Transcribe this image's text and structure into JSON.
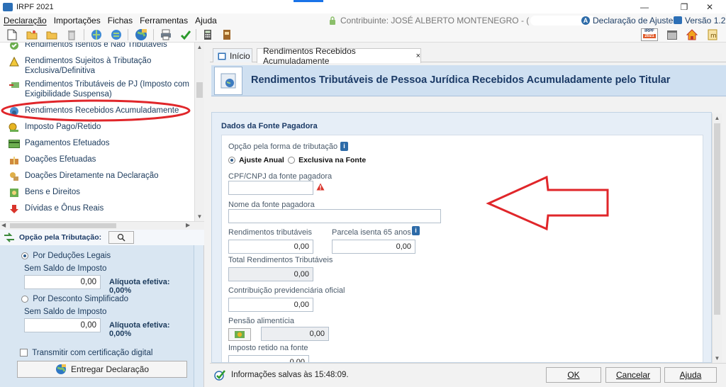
{
  "window": {
    "title": "IRPF 2021",
    "minimize": "—",
    "restore": "❐",
    "close": "✕"
  },
  "menu": {
    "items": [
      "Declaração",
      "Importações",
      "Fichas",
      "Ferramentas",
      "Ajuda"
    ]
  },
  "contribuinte": {
    "label": "Contribuinte: JOSÉ ALBERTO MONTENEGRO - ("
  },
  "declaracao_tipo": "Declaração de Ajuste",
  "versao": "Versão 1.2",
  "toolbar_badge": {
    "line1": "IRPF",
    "line2": "2021"
  },
  "nav": {
    "items": [
      {
        "label": "Rendimentos Isentos e Não Tributáveis",
        "icon": "check-icon"
      },
      {
        "label": "Rendimentos Sujeitos à Tributação Exclusiva/Definitiva",
        "icon": "warning-icon"
      },
      {
        "label": "Rendimentos Tributáveis de PJ (Imposto com Exigibilidade Suspensa)",
        "icon": "money-arrow-icon"
      },
      {
        "label": "Rendimentos Recebidos Acumuladamente",
        "icon": "globe-icon"
      },
      {
        "label": "Imposto Pago/Retido",
        "icon": "coin-icon"
      },
      {
        "label": "Pagamentos Efetuados",
        "icon": "card-icon"
      },
      {
        "label": "Doações Efetuadas",
        "icon": "gift-icon"
      },
      {
        "label": "Doações Diretamente na Declaração",
        "icon": "donation-icon"
      },
      {
        "label": "Bens e Direitos",
        "icon": "goods-icon"
      },
      {
        "label": "Dívidas e Ônus Reais",
        "icon": "down-arrow-icon"
      }
    ]
  },
  "tributacao": {
    "header": "Opção pela Tributação:",
    "deducoes": {
      "label": "Por Deduções Legais",
      "sub": "Sem Saldo de Imposto",
      "value": "0,00",
      "aliquota": "Alíquota efetiva: 0,00%"
    },
    "simplificado": {
      "label": "Por Desconto Simplificado",
      "sub": "Sem Saldo de Imposto",
      "value": "0,00",
      "aliquota": "Alíquota efetiva: 0,00%"
    },
    "certificado": "Transmitir com certificação digital",
    "entregar": "Entregar Declaração"
  },
  "tabs": [
    {
      "label": "Início"
    },
    {
      "label": "Rendimentos Recebidos Acumuladamente",
      "close": "×"
    }
  ],
  "page_title": "Rendimentos Tributáveis de Pessoa Jurídica Recebidos Acumuladamente pelo Titular",
  "form": {
    "section_title": "Dados da Fonte Pagadora",
    "opcao_label": "Opção pela forma de tributação",
    "opcao_ajuste": "Ajuste Anual",
    "opcao_exclusiva": "Exclusiva na Fonte",
    "cpf_label": "CPF/CNPJ da fonte pagadora",
    "cpf_value": "",
    "nome_label": "Nome da fonte pagadora",
    "nome_value": "",
    "rend_trib_label": "Rendimentos tributáveis",
    "rend_trib_value": "0,00",
    "parcela_label": "Parcela isenta 65 anos",
    "parcela_value": "0,00",
    "total_label": "Total Rendimentos Tributáveis",
    "total_value": "0,00",
    "contrib_label": "Contribuição previdenciária oficial",
    "contrib_value": "0,00",
    "pensao_label": "Pensão alimentícia",
    "pensao_value": "0,00",
    "imposto_label": "Imposto retido na fonte",
    "imposto_value": "0,00"
  },
  "status": {
    "saved": "Informações salvas às 15:48:09."
  },
  "buttons": {
    "ok": "OK",
    "cancel": "Cancelar",
    "help": "Ajuda"
  },
  "colors": {
    "annotation_red": "#e0262a",
    "header_band": "#cfe0f1",
    "accent_blue": "#1b3a66"
  }
}
